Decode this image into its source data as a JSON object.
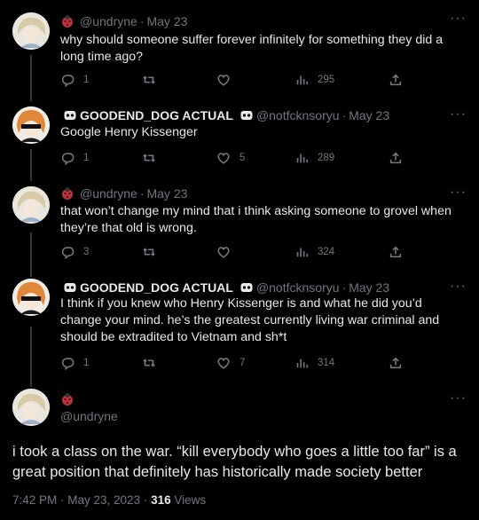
{
  "tweets": [
    {
      "handle": "@undryne",
      "date": "May 23",
      "text": "why should someone suffer forever infinitely for something they did a long time ago?",
      "replies": "1",
      "likes": "",
      "views": "295"
    },
    {
      "name": "GOODEND_DOG ACTUAL",
      "handle": "@notfcknsoryu",
      "date": "May 23",
      "text": "Google Henry Kissenger",
      "replies": "1",
      "likes": "5",
      "views": "289"
    },
    {
      "handle": "@undryne",
      "date": "May 23",
      "text": "that won’t change my mind that i think asking someone to grovel when they’re that old is wrong.",
      "replies": "3",
      "likes": "",
      "views": "324"
    },
    {
      "name": "GOODEND_DOG ACTUAL",
      "handle": "@notfcknsoryu",
      "date": "May 23",
      "text": "I think if you knew who Henry Kissenger is and what he did you’d change your mind. he’s the greatest currently living war criminal and should be extradited to Vietnam and sh*t",
      "replies": "1",
      "likes": "7",
      "views": "314"
    }
  ],
  "main": {
    "handle": "@undryne",
    "text": "i took a class on the war. “kill everybody who goes a little too far” is a great position that definitely has historically made society better",
    "time": "7:42 PM · May 23, 2023 ·",
    "views_count": "316",
    "views_label": "Views"
  },
  "more_glyph": "···",
  "colors": {
    "bg": "#000000",
    "text": "#e7e9ea",
    "muted": "#71767b",
    "line": "#333639"
  }
}
